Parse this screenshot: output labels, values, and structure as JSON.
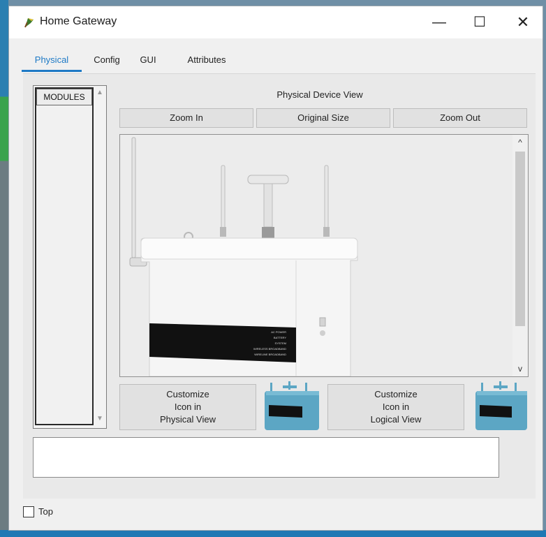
{
  "window": {
    "title": "Home Gateway",
    "controls": {
      "minimize": "—",
      "maximize": "☐",
      "close": "✕"
    }
  },
  "tabs": [
    {
      "label": "Physical",
      "active": true
    },
    {
      "label": "Config",
      "active": false
    },
    {
      "label": "GUI",
      "active": false
    },
    {
      "label": "Attributes",
      "active": false
    }
  ],
  "modules": {
    "header": "MODULES"
  },
  "physical_view": {
    "label": "Physical Device View",
    "zoom_in": "Zoom In",
    "original_size": "Original Size",
    "zoom_out": "Zoom Out",
    "device_indicators": [
      "AC POWER",
      "BATTERY",
      "SYSTEM",
      "WIRELESS BROADBAND",
      "WIRELINE BROADBAND"
    ]
  },
  "customize": {
    "physical": {
      "line1": "Customize",
      "line2": "Icon in",
      "line3": "Physical View"
    },
    "logical": {
      "line1": "Customize",
      "line2": "Icon in",
      "line3": "Logical View"
    }
  },
  "footer": {
    "top_checkbox": "Top",
    "top_checked": false
  },
  "colors": {
    "accent": "#1e7ac6",
    "device_icon": "#5ca6c4"
  }
}
